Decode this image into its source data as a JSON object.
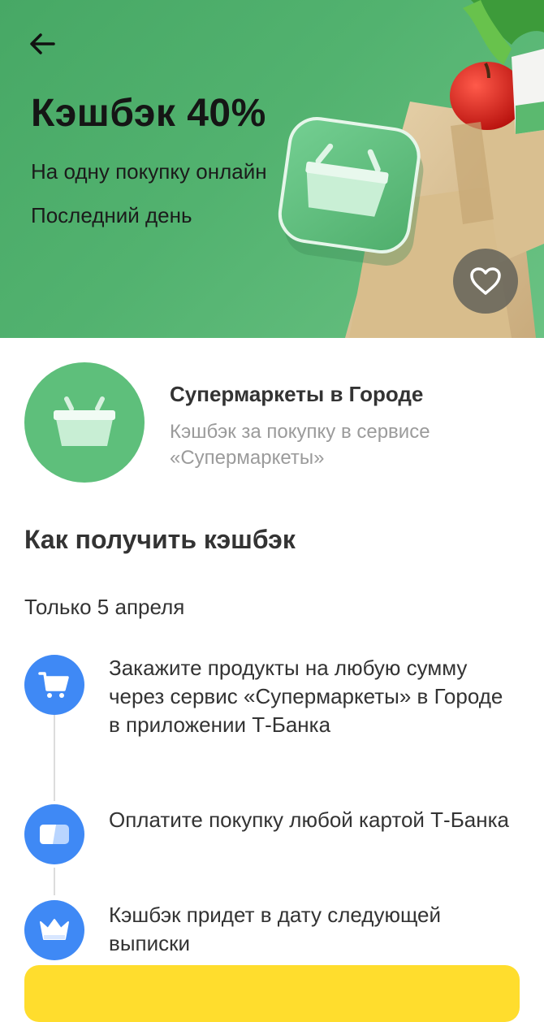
{
  "hero": {
    "title": "Кэшбэк 40%",
    "subtitle": "На одну покупку онлайн",
    "deadline": "Последний день",
    "colors": {
      "background": "#52b26f",
      "tile": "#5cbf7c"
    }
  },
  "icons": {
    "back": "arrow-left-icon",
    "favorite": "heart-icon",
    "partner": "basket-icon",
    "step1": "shopping-cart-icon",
    "step2": "payment-card-icon",
    "step3": "crown-icon"
  },
  "partner": {
    "name": "Супермаркеты в Городе",
    "description": "Кэшбэк за покупку в сервисе «Супермаркеты»"
  },
  "how_to": {
    "title": "Как получить кэшбэк",
    "period": "Только 5 апреля",
    "steps": [
      {
        "text": "Закажите продукты на любую сумму через сервис «Супермаркеты» в Городе в приложении Т-Банка"
      },
      {
        "text": "Оплатите покупку любой картой Т-Банка"
      },
      {
        "text": "Кэшбэк придет в дату следующей выписки"
      }
    ]
  },
  "colors": {
    "accent_green": "#5ebf7b",
    "step_blue": "#3f89f5",
    "button_yellow": "#ffdd2d",
    "secondary_text": "#9b9b9b"
  }
}
